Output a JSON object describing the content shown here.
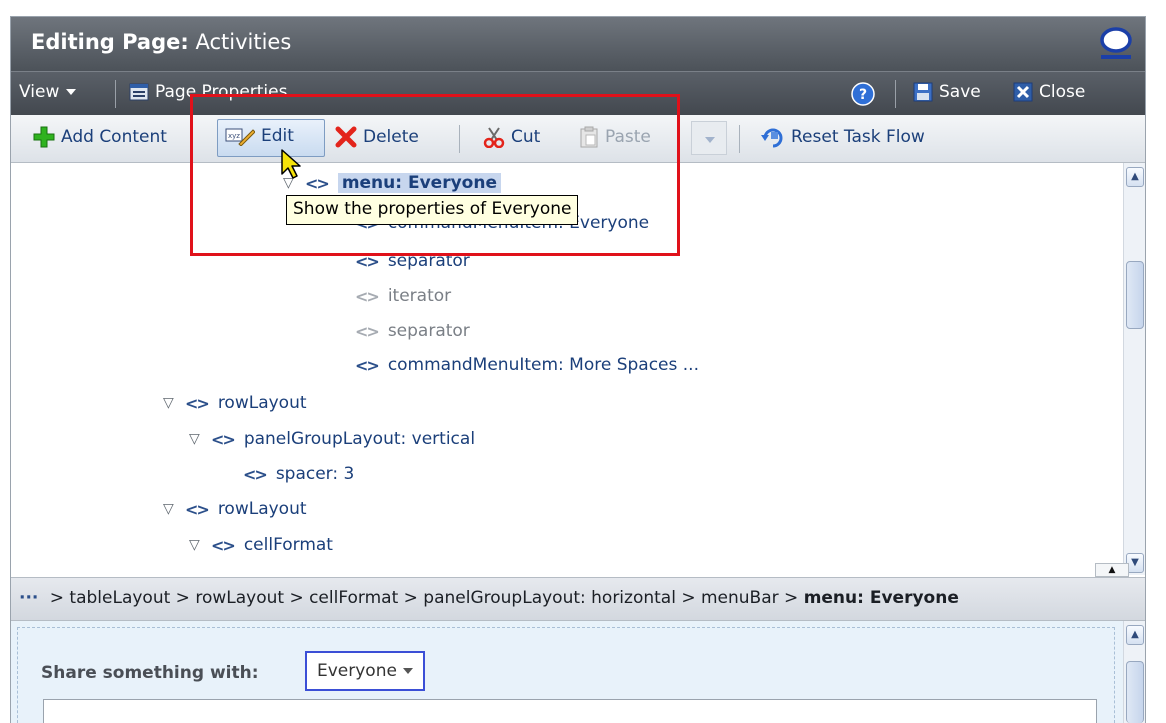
{
  "titlebar": {
    "label": "Editing Page:",
    "page_name": "Activities"
  },
  "viewbar": {
    "view_label": "View",
    "page_properties_label": "Page Properties",
    "save_label": "Save",
    "close_label": "Close"
  },
  "toolbar": {
    "add_content_label": "Add Content",
    "edit_label": "Edit",
    "delete_label": "Delete",
    "cut_label": "Cut",
    "paste_label": "Paste",
    "reset_task_flow_label": "Reset Task Flow"
  },
  "tooltip": {
    "text": "Show the properties of Everyone"
  },
  "tree": {
    "nodes": [
      {
        "label": "menu: Everyone"
      },
      {
        "label": "commandMenuItem: Everyone"
      },
      {
        "label": "separator"
      },
      {
        "label": "iterator"
      },
      {
        "label": "separator"
      },
      {
        "label": "commandMenuItem: More Spaces ..."
      },
      {
        "label": "rowLayout"
      },
      {
        "label": "panelGroupLayout: vertical"
      },
      {
        "label": "spacer: 3"
      },
      {
        "label": "rowLayout"
      },
      {
        "label": "cellFormat"
      }
    ]
  },
  "breadcrumb": {
    "dots": "···",
    "path": " > tableLayout > rowLayout > cellFormat > panelGroupLayout: horizontal > menuBar > ",
    "current": "menu: Everyone"
  },
  "share": {
    "label": "Share something with:",
    "selected": "Everyone"
  },
  "colors": {
    "highlight": "#e0111a",
    "link": "#1b3f7a",
    "titlebar": "#5b6169"
  }
}
